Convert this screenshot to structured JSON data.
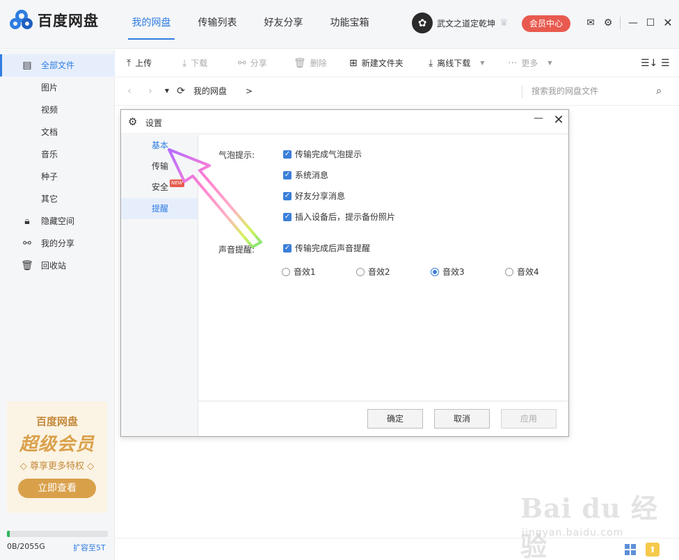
{
  "app": {
    "logo_text": "百度网盘",
    "tabs": [
      {
        "label": "我的网盘"
      },
      {
        "label": "传输列表"
      },
      {
        "label": "好友分享"
      },
      {
        "label": "功能宝箱"
      }
    ],
    "user_name": "武文之道定乾坤",
    "vip_button": "会员中心"
  },
  "sidebar": {
    "items": [
      {
        "label": "全部文件",
        "icon": "file-icon"
      },
      {
        "label": "图片"
      },
      {
        "label": "视频"
      },
      {
        "label": "文档"
      },
      {
        "label": "音乐"
      },
      {
        "label": "种子"
      },
      {
        "label": "其它"
      },
      {
        "label": "隐藏空间",
        "icon": "lock-icon"
      },
      {
        "label": "我的分享",
        "icon": "share-icon"
      },
      {
        "label": "回收站",
        "icon": "trash-icon"
      }
    ],
    "promo": {
      "title": "百度网盘",
      "subtitle": "超级会员",
      "tagline": "◇ 尊享更多特权 ◇",
      "button": "立即查看"
    },
    "storage": {
      "used": "0B/2055G",
      "expand": "扩容至5T",
      "fraction": 0.03
    }
  },
  "toolbar": {
    "upload": "上传",
    "download": "下载",
    "share": "分享",
    "delete": "删除",
    "new_folder": "新建文件夹",
    "offline_download": "离线下载",
    "more": "更多"
  },
  "address": {
    "crumb": "我的网盘",
    "crumb_sep": ">",
    "search_placeholder": "搜索我的网盘文件"
  },
  "dialog": {
    "title": "设置",
    "tabs": [
      {
        "label": "基本"
      },
      {
        "label": "传输"
      },
      {
        "label": "安全",
        "badge": "NEW"
      },
      {
        "label": "提醒"
      }
    ],
    "bubble_label": "气泡提示:",
    "bubble_options": [
      {
        "label": "传输完成气泡提示"
      },
      {
        "label": "系统消息"
      },
      {
        "label": "好友分享消息"
      },
      {
        "label": "插入设备后，提示备份照片"
      }
    ],
    "sound_label": "声音提醒:",
    "sound_checkbox": "传输完成后声音提醒",
    "sound_options": [
      {
        "label": "音效1"
      },
      {
        "label": "音效2"
      },
      {
        "label": "音效3"
      },
      {
        "label": "音效4"
      }
    ],
    "buttons": {
      "ok": "确定",
      "cancel": "取消",
      "apply": "应用"
    }
  },
  "watermark": {
    "main": "Bai du 经验",
    "sub": "jingyan.baidu.com"
  },
  "colors": {
    "accent": "#2f7de1",
    "vip": "#e85a4f",
    "promo_gold": "#d9a04a"
  }
}
